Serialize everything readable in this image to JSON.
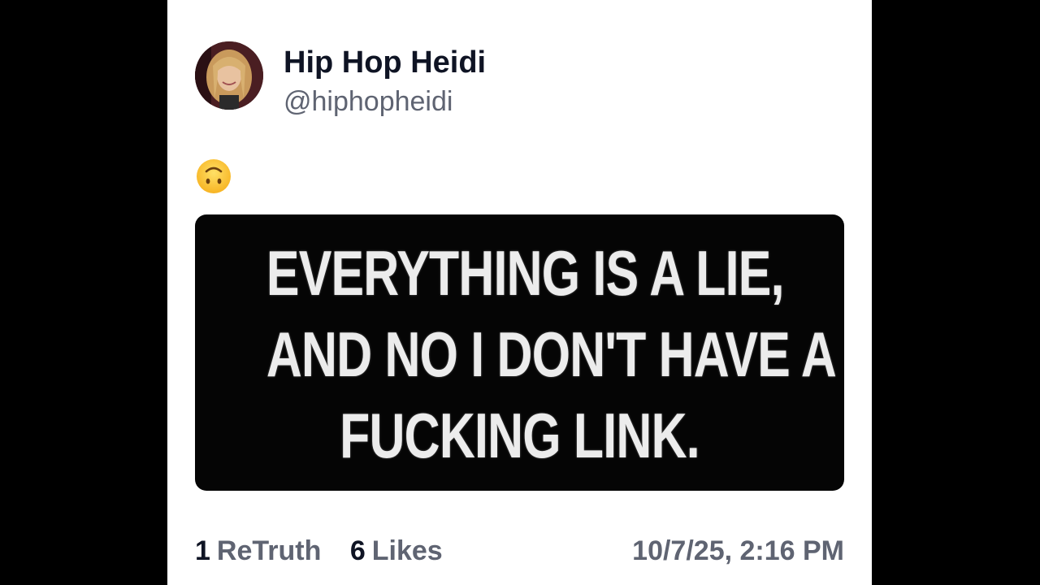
{
  "post": {
    "author": {
      "display_name": "Hip Hop Heidi",
      "handle": "@hiphopheidi",
      "avatar_icon": "profile-photo"
    },
    "emoji_icon": "upside-down-face-emoji",
    "image": {
      "lines": [
        "EVERYTHING IS A LIE,",
        "AND NO I DON'T HAVE A",
        "FUCKING LINK."
      ]
    },
    "stats": {
      "retruths_count": "1",
      "retruths_label": "ReTruth",
      "likes_count": "6",
      "likes_label": "Likes"
    },
    "timestamp": "10/7/25, 2:16 PM"
  },
  "colors": {
    "name_text": "#0f1424",
    "secondary_text": "#5f6472",
    "background": "#ffffff",
    "frame": "#000000"
  }
}
